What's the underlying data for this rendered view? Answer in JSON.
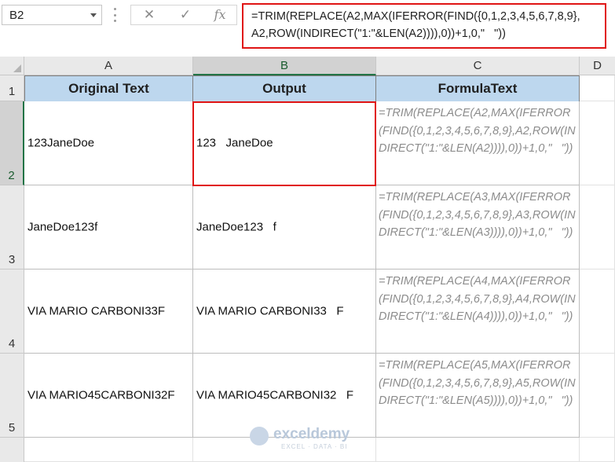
{
  "formula_bar": {
    "name_box": "B2",
    "cancel_icon": "✕",
    "enter_icon": "✓",
    "fx_label": "fx",
    "formula": "=TRIM(REPLACE(A2,MAX(IFERROR(FIND({0,1,2,3,4,5,6,7,8,9},\nA2,ROW(INDIRECT(\"1:\"&LEN(A2)))),0))+1,0,\"   \"))"
  },
  "columns": [
    "A",
    "B",
    "C",
    "D"
  ],
  "rows": [
    "1",
    "2",
    "3",
    "4",
    "5"
  ],
  "table": {
    "headers": [
      "Original Text",
      "Output",
      "FormulaText"
    ],
    "rows": [
      {
        "original": "123JaneDoe",
        "output": "123   JaneDoe",
        "formula_text": "=TRIM(REPLACE(A2,MAX(IFERROR(FIND({0,1,2,3,4,5,6,7,8,9},A2,ROW(INDIRECT(\"1:\"&LEN(A2)))),0))+1,0,\"   \"))"
      },
      {
        "original": "JaneDoe123f",
        "output": "JaneDoe123   f",
        "formula_text": "=TRIM(REPLACE(A3,MAX(IFERROR(FIND({0,1,2,3,4,5,6,7,8,9},A3,ROW(INDIRECT(\"1:\"&LEN(A3)))),0))+1,0,\"   \"))"
      },
      {
        "original": "VIA MARIO CARBONI33F",
        "output": "VIA MARIO CARBONI33   F",
        "formula_text": "=TRIM(REPLACE(A4,MAX(IFERROR(FIND({0,1,2,3,4,5,6,7,8,9},A4,ROW(INDIRECT(\"1:\"&LEN(A4)))),0))+1,0,\"   \"))"
      },
      {
        "original": "VIA MARIO45CARBONI32F",
        "output": "VIA MARIO45CARBONI32   F",
        "formula_text": "=TRIM(REPLACE(A5,MAX(IFERROR(FIND({0,1,2,3,4,5,6,7,8,9},A5,ROW(INDIRECT(\"1:\"&LEN(A5)))),0))+1,0,\"   \"))"
      }
    ]
  },
  "watermark": {
    "name": "exceldemy",
    "tagline": "EXCEL · DATA · BI"
  },
  "colors": {
    "header_fill": "#bdd7ee",
    "highlight_border": "#e01414",
    "selected_accent": "#217346",
    "formula_text_color": "#8c8c8c"
  }
}
